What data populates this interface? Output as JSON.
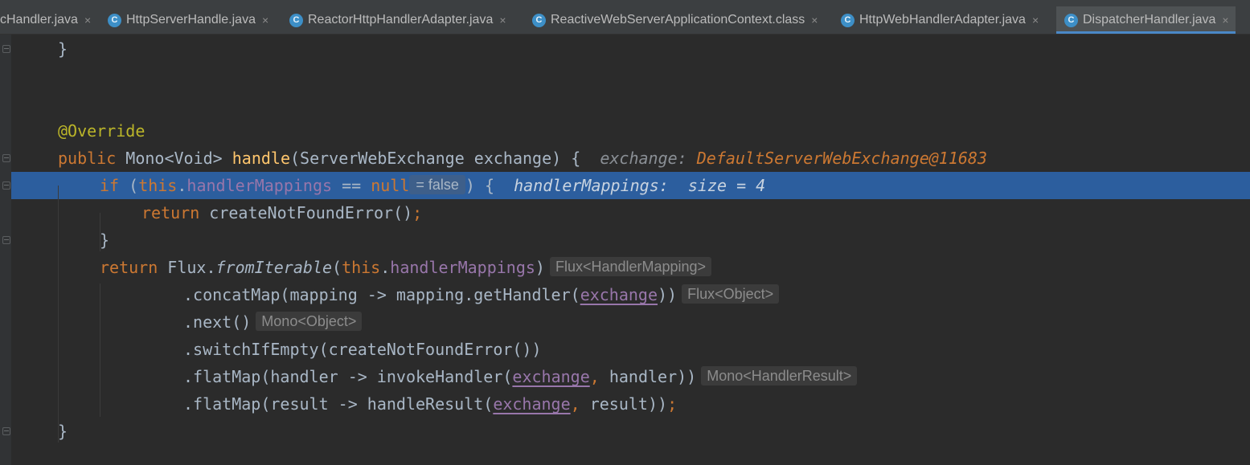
{
  "tabs": [
    {
      "label": "cHandler.java",
      "icon": "",
      "active": false
    },
    {
      "label": "HttpServerHandle.java",
      "icon": "C",
      "active": false
    },
    {
      "label": "ReactorHttpHandlerAdapter.java",
      "icon": "C",
      "active": false
    },
    {
      "label": "ReactiveWebServerApplicationContext.class",
      "icon": "C",
      "active": false
    },
    {
      "label": "HttpWebHandlerAdapter.java",
      "icon": "C",
      "active": false
    },
    {
      "label": "DispatcherHandler.java",
      "icon": "C",
      "active": true
    }
  ],
  "tab_close_glyph": "×",
  "code": {
    "l1_brace": "}",
    "annotation": "@Override",
    "kw_public": "public",
    "type_mono_void": "Mono<Void>",
    "method_handle": "handle",
    "param_sig": "(ServerWebExchange exchange) {",
    "debug_exchange_label": "exchange:",
    "debug_exchange_value": "DefaultServerWebExchange@11683",
    "kw_if": "if",
    "paren_open": "(",
    "kw_this": "this",
    "dot": ".",
    "field_handler_mappings": "handlerMappings",
    "eq_op": " == ",
    "kw_null": "null",
    "inlay_false": "= false",
    "if_close": ") {",
    "debug_mappings_label": "handlerMappings:",
    "debug_mappings_value": "size = 4",
    "kw_return": "return",
    "create_not_found": "createNotFoundError()",
    "semicolon": ";",
    "close_brace": "}",
    "flux_prefix": "Flux.",
    "from_iterable": "fromIterable",
    "paren_close": ")",
    "inlay_flux_mapping": "Flux<HandlerMapping>",
    "concat_prefix": ".concatMap(mapping -> mapping.getHandler(",
    "exchange": "exchange",
    "concat_suffix": "))",
    "inlay_flux_object": "Flux<Object>",
    "next": ".next()",
    "inlay_mono_object": "Mono<Object>",
    "switch_if_empty": ".switchIfEmpty(createNotFoundError())",
    "flatmap1_prefix": ".flatMap(handler -> invokeHandler(",
    "comma": ",",
    "flatmap1_suffix": " handler))",
    "inlay_mono_result": "Mono<HandlerResult>",
    "flatmap2_prefix": ".flatMap(result -> handleResult(",
    "flatmap2_suffix": " result))",
    "end_brace": "}"
  },
  "colors": {
    "background": "#2b2b2b",
    "keyword": "#cc7832",
    "annotation": "#bbb529",
    "method": "#ffc66d",
    "field": "#9876aa",
    "text": "#a9b7c6",
    "execution_line": "#2c5e9e",
    "active_tab_underline": "#4a88c7"
  }
}
